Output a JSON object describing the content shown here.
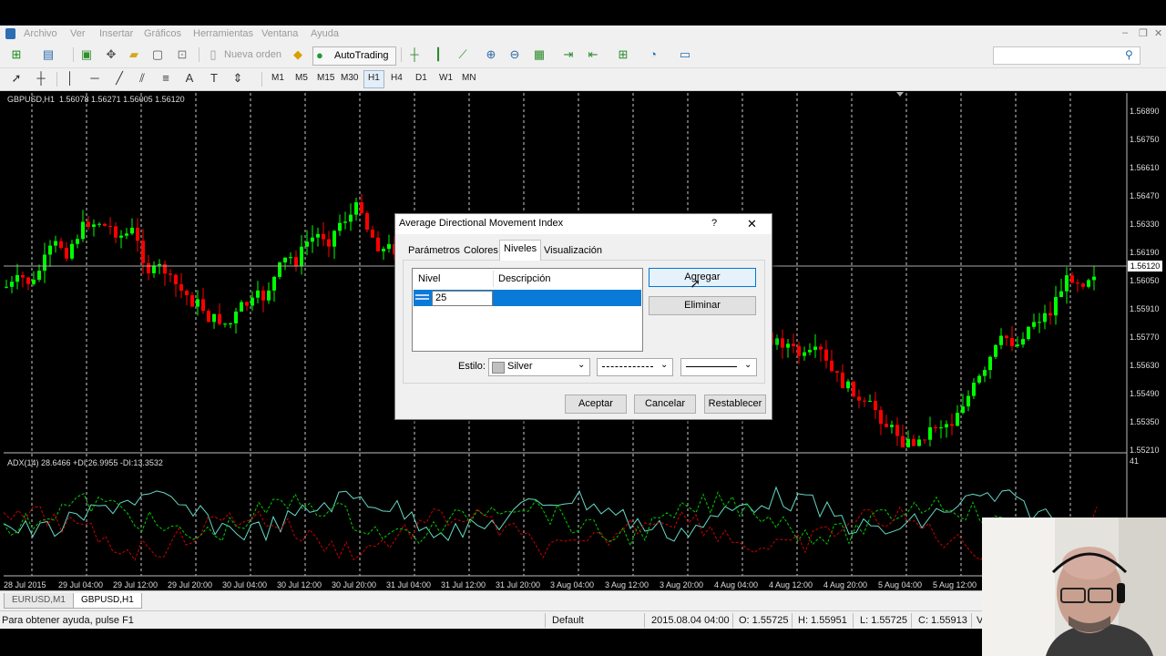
{
  "menu": [
    "Archivo",
    "Ver",
    "Insertar",
    "Gráficos",
    "Herramientas",
    "Ventana",
    "Ayuda"
  ],
  "toolbar": {
    "new_order": "Nueva orden",
    "autotrading": "AutoTrading",
    "timeframes": [
      "M1",
      "M5",
      "M15",
      "M30",
      "H1",
      "H4",
      "D1",
      "W1",
      "MN"
    ],
    "active_timeframe": "H1"
  },
  "chart": {
    "header": "GBPUSD,H1  1.56078 1.56271 1.56005 1.56120",
    "indicator_header": "ADX(14) 28.6466 +DI:26.9955 -DI:13.3532",
    "indicator_scale_top": "41",
    "current_price": "1.56120",
    "price_labels": [
      "1.56890",
      "1.56750",
      "1.56610",
      "1.56470",
      "1.56330",
      "1.56190",
      "1.56050",
      "1.55910",
      "1.55770",
      "1.55630",
      "1.55490",
      "1.55350",
      "1.55210"
    ],
    "time_labels": [
      "28 Jul 2015",
      "29 Jul 04:00",
      "29 Jul 12:00",
      "29 Jul 20:00",
      "30 Jul 04:00",
      "30 Jul 12:00",
      "30 Jul 20:00",
      "31 Jul 04:00",
      "31 Jul 12:00",
      "31 Jul 20:00",
      "3 Aug 04:00",
      "3 Aug 12:00",
      "3 Aug 20:00",
      "4 Aug 04:00",
      "4 Aug 12:00",
      "4 Aug 20:00",
      "5 Aug 04:00",
      "5 Aug 12:00"
    ],
    "colors": {
      "bull": "#00ff00",
      "bear": "#ff0000",
      "adx": "#66d9c6",
      "plus_di": "#00cc00",
      "minus_di": "#cc0000",
      "background": "#000000"
    }
  },
  "chart_tabs": [
    "EURUSD,M1",
    "GBPUSD,H1"
  ],
  "active_chart_tab": "GBPUSD,H1",
  "status": {
    "help": "Para obtener ayuda, pulse F1",
    "profile": "Default",
    "datetime": "2015.08.04 04:00",
    "open": "O: 1.55725",
    "high": "H: 1.55951",
    "low": "L: 1.55725",
    "close": "C: 1.55913",
    "trailing": "V"
  },
  "dialog": {
    "title": "Average Directional Movement Index",
    "help_glyph": "?",
    "close_glyph": "✕",
    "tabs": [
      "Parámetros",
      "Colores",
      "Niveles",
      "Visualización"
    ],
    "active_tab": "Niveles",
    "columns": [
      "Nivel",
      "Descripción"
    ],
    "level_value": "25",
    "add_button": "Agregar",
    "remove_button": "Eliminar",
    "style_label": "Estilo:",
    "style_color": "Silver",
    "swatch_color": "#c0c0c0",
    "ok_button": "Aceptar",
    "cancel_button": "Cancelar",
    "reset_button": "Restablecer"
  }
}
